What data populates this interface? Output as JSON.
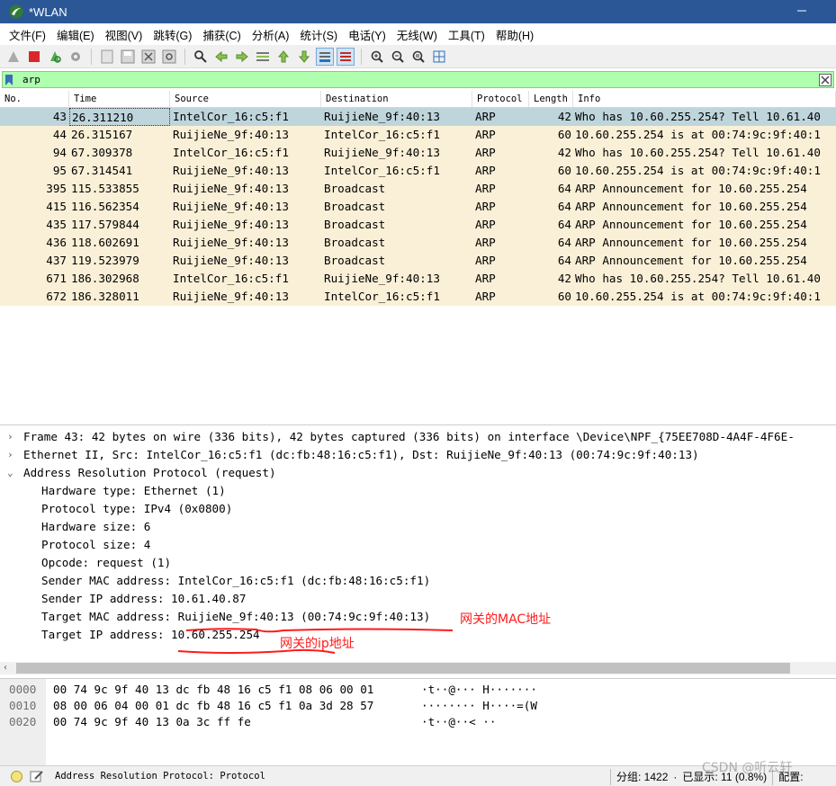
{
  "window": {
    "title": "*WLAN"
  },
  "menu": [
    "文件(F)",
    "编辑(E)",
    "视图(V)",
    "跳转(G)",
    "捕获(C)",
    "分析(A)",
    "统计(S)",
    "电话(Y)",
    "无线(W)",
    "工具(T)",
    "帮助(H)"
  ],
  "filter": {
    "value": "arp"
  },
  "packet_list": {
    "headers": {
      "no": "No.",
      "time": "Time",
      "source": "Source",
      "destination": "Destination",
      "protocol": "Protocol",
      "length": "Length",
      "info": "Info"
    },
    "rows": [
      {
        "no": "43",
        "time": "26.311210",
        "source": "IntelCor_16:c5:f1",
        "destination": "RuijieNe_9f:40:13",
        "protocol": "ARP",
        "length": "42",
        "info": "Who has 10.60.255.254? Tell 10.61.40"
      },
      {
        "no": "44",
        "time": "26.315167",
        "source": "RuijieNe_9f:40:13",
        "destination": "IntelCor_16:c5:f1",
        "protocol": "ARP",
        "length": "60",
        "info": "10.60.255.254 is at 00:74:9c:9f:40:1"
      },
      {
        "no": "94",
        "time": "67.309378",
        "source": "IntelCor_16:c5:f1",
        "destination": "RuijieNe_9f:40:13",
        "protocol": "ARP",
        "length": "42",
        "info": "Who has 10.60.255.254? Tell 10.61.40"
      },
      {
        "no": "95",
        "time": "67.314541",
        "source": "RuijieNe_9f:40:13",
        "destination": "IntelCor_16:c5:f1",
        "protocol": "ARP",
        "length": "60",
        "info": "10.60.255.254 is at 00:74:9c:9f:40:1"
      },
      {
        "no": "395",
        "time": "115.533855",
        "source": "RuijieNe_9f:40:13",
        "destination": "Broadcast",
        "protocol": "ARP",
        "length": "64",
        "info": "ARP Announcement for 10.60.255.254"
      },
      {
        "no": "415",
        "time": "116.562354",
        "source": "RuijieNe_9f:40:13",
        "destination": "Broadcast",
        "protocol": "ARP",
        "length": "64",
        "info": "ARP Announcement for 10.60.255.254"
      },
      {
        "no": "435",
        "time": "117.579844",
        "source": "RuijieNe_9f:40:13",
        "destination": "Broadcast",
        "protocol": "ARP",
        "length": "64",
        "info": "ARP Announcement for 10.60.255.254"
      },
      {
        "no": "436",
        "time": "118.602691",
        "source": "RuijieNe_9f:40:13",
        "destination": "Broadcast",
        "protocol": "ARP",
        "length": "64",
        "info": "ARP Announcement for 10.60.255.254"
      },
      {
        "no": "437",
        "time": "119.523979",
        "source": "RuijieNe_9f:40:13",
        "destination": "Broadcast",
        "protocol": "ARP",
        "length": "64",
        "info": "ARP Announcement for 10.60.255.254"
      },
      {
        "no": "671",
        "time": "186.302968",
        "source": "IntelCor_16:c5:f1",
        "destination": "RuijieNe_9f:40:13",
        "protocol": "ARP",
        "length": "42",
        "info": "Who has 10.60.255.254? Tell 10.61.40"
      },
      {
        "no": "672",
        "time": "186.328011",
        "source": "RuijieNe_9f:40:13",
        "destination": "IntelCor_16:c5:f1",
        "protocol": "ARP",
        "length": "60",
        "info": "10.60.255.254 is at 00:74:9c:9f:40:1"
      }
    ]
  },
  "details": {
    "frame": "Frame 43: 42 bytes on wire (336 bits), 42 bytes captured (336 bits) on interface \\Device\\NPF_{75EE708D-4A4F-4F6E-",
    "ethernet": "Ethernet II, Src: IntelCor_16:c5:f1 (dc:fb:48:16:c5:f1), Dst: RuijieNe_9f:40:13 (00:74:9c:9f:40:13)",
    "arp": "Address Resolution Protocol (request)",
    "arp_fields": [
      "Hardware type: Ethernet (1)",
      "Protocol type: IPv4 (0x0800)",
      "Hardware size: 6",
      "Protocol size: 4",
      "Opcode: request (1)",
      "Sender MAC address: IntelCor_16:c5:f1 (dc:fb:48:16:c5:f1)",
      "Sender IP address: 10.61.40.87",
      "Target MAC address: RuijieNe_9f:40:13 (00:74:9c:9f:40:13)",
      "Target IP address: 10.60.255.254"
    ]
  },
  "annotations": {
    "gateway_mac": "网关的MAC地址",
    "gateway_ip": "网关的ip地址",
    "annotation_color": "#ff1a1a"
  },
  "bytes": [
    {
      "offset": "0000",
      "hex": "00 74 9c 9f 40 13 dc fb  48 16 c5 f1 08 06 00 01",
      "ascii": "·t··@··· H·······"
    },
    {
      "offset": "0010",
      "hex": "08 00 06 04 00 01 dc fb  48 16 c5 f1 0a 3d 28 57",
      "ascii": "········ H····=(W"
    },
    {
      "offset": "0020",
      "hex": "00 74 9c 9f 40 13 0a 3c  ff fe",
      "ascii": "·t··@··< ··"
    }
  ],
  "status": {
    "text": "Address Resolution Protocol: Protocol",
    "packets": "分组: 1422",
    "displayed": "已显示: 11 (0.8%)",
    "profile": "配置:"
  },
  "watermark": "CSDN @听云轩",
  "colors": {
    "titlebar": "#2b5797",
    "row_bg": "#faf0d7",
    "selected_row": "#bed5dc",
    "filter_bg": "#afffaf"
  }
}
